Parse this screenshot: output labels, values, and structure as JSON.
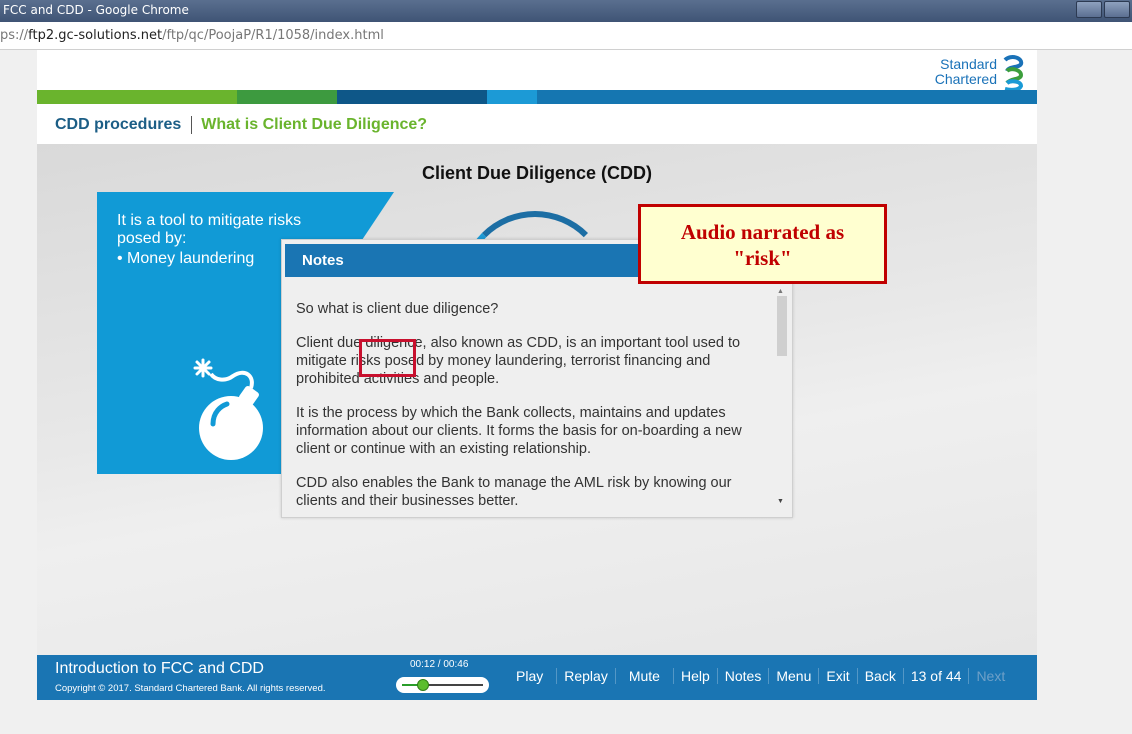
{
  "browser": {
    "title": "FCC and CDD - Google Chrome",
    "url_scheme": "ps://",
    "url_host": "ftp2.gc-solutions.net",
    "url_path": "/ftp/qc/PoojaP/R1/1058/index.html"
  },
  "brand": {
    "logo_line1": "Standard",
    "logo_line2": "Chartered",
    "colors": [
      "#6ab42d",
      "#3d9a3f",
      "#0e5788",
      "#1576b1",
      "#1c9ad6",
      "#1576b1"
    ]
  },
  "breadcrumb": {
    "section": "CDD procedures",
    "page": "What is Client Due Diligence?"
  },
  "slide": {
    "title": "Client Due Diligence (CDD)",
    "card_text": "It is a tool to mitigate risks posed by:",
    "card_bullet": "Money laundering",
    "card_icon": "bomb-icon"
  },
  "notes": {
    "title": "Notes",
    "paragraphs": [
      "So what is client due diligence?",
      "Client due diligence, also known as CDD, is an important tool used to mitigate risks posed by money laundering, terrorist financing and prohibited activities and people.",
      "It is the process by which the Bank collects, maintains and updates information about our clients. It forms the basis for on-boarding a new client or continue with an existing relationship.",
      "CDD also enables the Bank to manage the AML risk by knowing our clients and their businesses better."
    ]
  },
  "callout": {
    "text": "Audio narrated as \"risk\""
  },
  "footer": {
    "course_name": "Introduction to FCC and CDD",
    "copyright": "Copyright © 2017. Standard Chartered Bank. All rights reserved.",
    "time": "00:12 / 00:46",
    "progress": 0.26,
    "nav": {
      "play": "Play",
      "replay": "Replay",
      "mute": "Mute",
      "help": "Help",
      "notes": "Notes",
      "menu": "Menu",
      "exit": "Exit",
      "back": "Back",
      "page": "13 of 44",
      "next": "Next"
    }
  }
}
